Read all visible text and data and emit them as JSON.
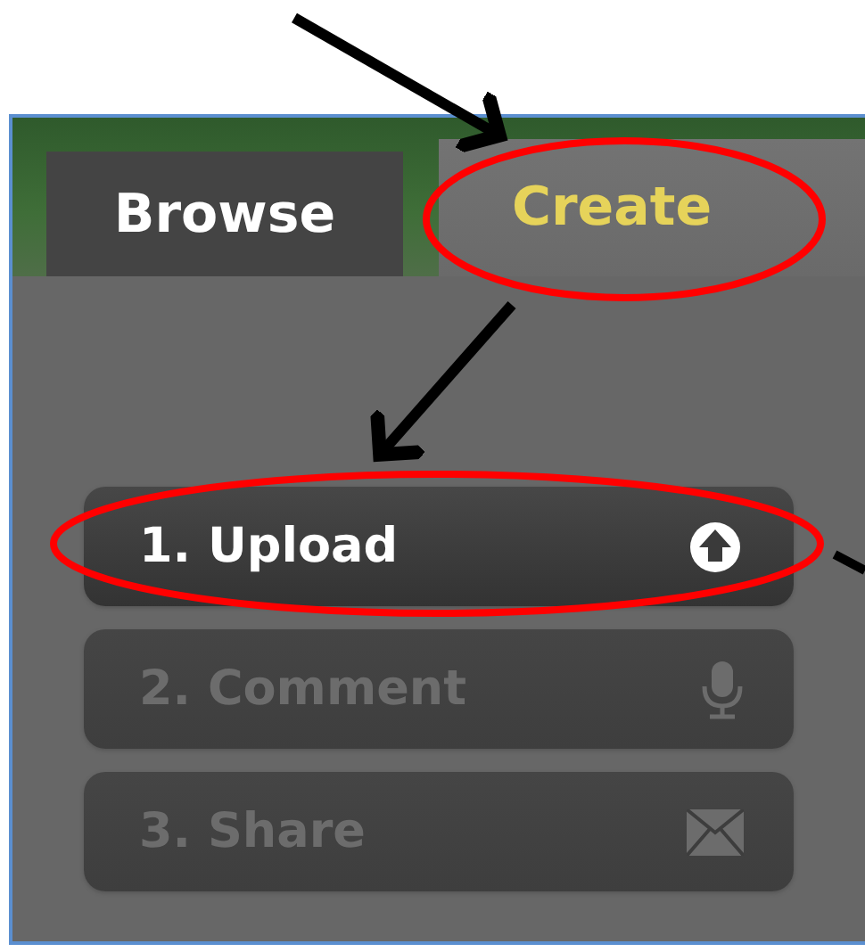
{
  "tabs": [
    {
      "label": "Browse",
      "selected": false
    },
    {
      "label": "Create",
      "selected": true
    }
  ],
  "steps": [
    {
      "label": "1. Upload",
      "kind": "upload",
      "disabled": false
    },
    {
      "label": "2. Comment",
      "kind": "microphone",
      "disabled": true
    },
    {
      "label": "3. Share",
      "kind": "envelope",
      "disabled": true
    }
  ]
}
